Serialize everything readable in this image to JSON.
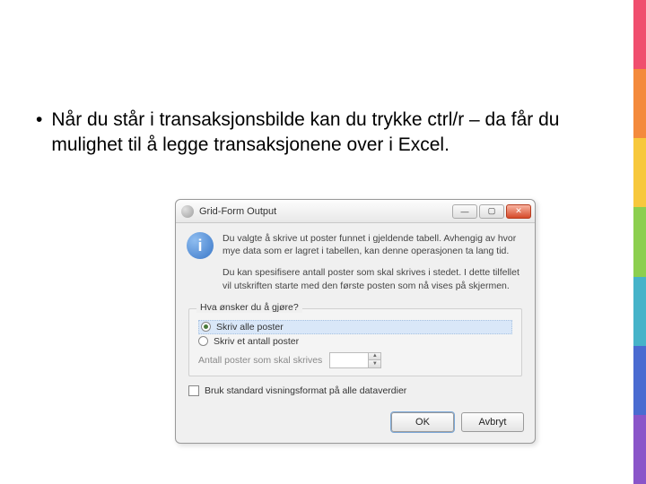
{
  "bullet": {
    "text": "Når du står i transaksjonsbilde kan du trykke ctrl/r – da får du mulighet til å legge transaksjonene over i Excel."
  },
  "dialog": {
    "title": "Grid-Form Output",
    "message1": "Du valgte å skrive ut poster funnet i gjeldende tabell. Avhengig av hvor mye data som er lagret i tabellen, kan denne operasjonen ta lang tid.",
    "message2": "Du kan spesifisere antall poster som skal skrives i stedet. I dette tilfellet vil utskriften starte med den første posten som nå vises på skjermen.",
    "group_legend": "Hva ønsker du å gjøre?",
    "radio_all": "Skriv alle poster",
    "radio_some": "Skriv et antall poster",
    "count_label": "Antall poster som skal skrives",
    "checkbox_label": "Bruk standard visningsformat på alle dataverdier",
    "ok": "OK",
    "cancel": "Avbryt"
  }
}
